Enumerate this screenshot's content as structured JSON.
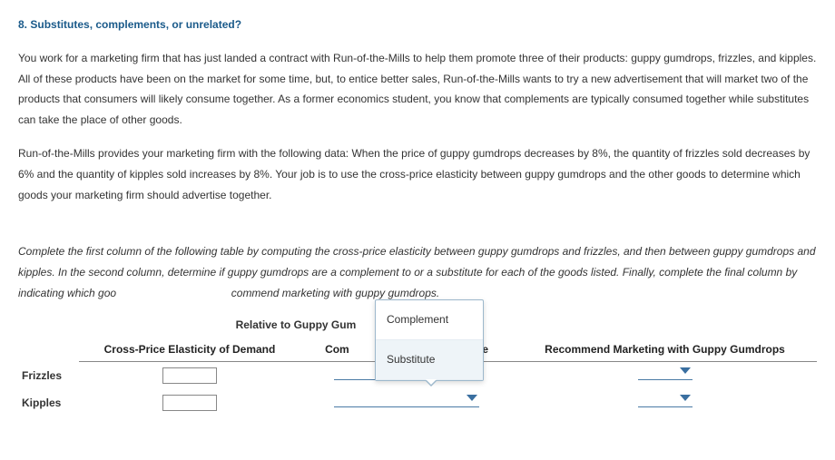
{
  "question": {
    "number": "8.",
    "title": "Substitutes, complements, or unrelated?"
  },
  "paragraphs": {
    "p1": "You work for a marketing firm that has just landed a contract with Run-of-the-Mills to help them promote three of their products: guppy gumdrops, frizzles, and kipples. All of these products have been on the market for some time, but, to entice better sales, Run-of-the-Mills wants to try a new advertisement that will market two of the products that consumers will likely consume together. As a former economics student, you know that complements are typically consumed together while substitutes can take the place of other goods.",
    "p2": "Run-of-the-Mills provides your marketing firm with the following data: When the price of guppy gumdrops decreases by 8%, the quantity of frizzles sold decreases by 6% and the quantity of kipples sold increases by 8%. Your job is to use the cross-price elasticity between guppy gumdrops and the other goods to determine which goods your marketing firm should advertise together."
  },
  "instructions": {
    "line1": "Complete the first column of the following table by computing the cross-price elasticity between guppy gumdrops and frizzles, and then between guppy gumdrops and kipples. In the second column, determine if guppy gumdrops are a complement to or a substitute for each of the goods listed. Finally, complete the final column by indicating which goo",
    "line1_tail": "commend marketing with guppy gumdrops."
  },
  "table": {
    "super_header": "Relative to Guppy Gumdrops",
    "headers": {
      "cross_price": "Cross-Price Elasticity of Demand",
      "comp_sub": "Complement or Substitute",
      "recommend": "Recommend Marketing with Guppy Gumdrops"
    },
    "rows": [
      {
        "label": "Frizzles",
        "value": "",
        "comp_sub": "",
        "recommend": ""
      },
      {
        "label": "Kipples",
        "value": "",
        "comp_sub": "",
        "recommend": ""
      }
    ]
  },
  "dropdown_menu": {
    "options": [
      "Complement",
      "Substitute"
    ],
    "selected": "Substitute"
  },
  "colors": {
    "title": "#1a5a8a",
    "caret": "#3a6fa0"
  }
}
